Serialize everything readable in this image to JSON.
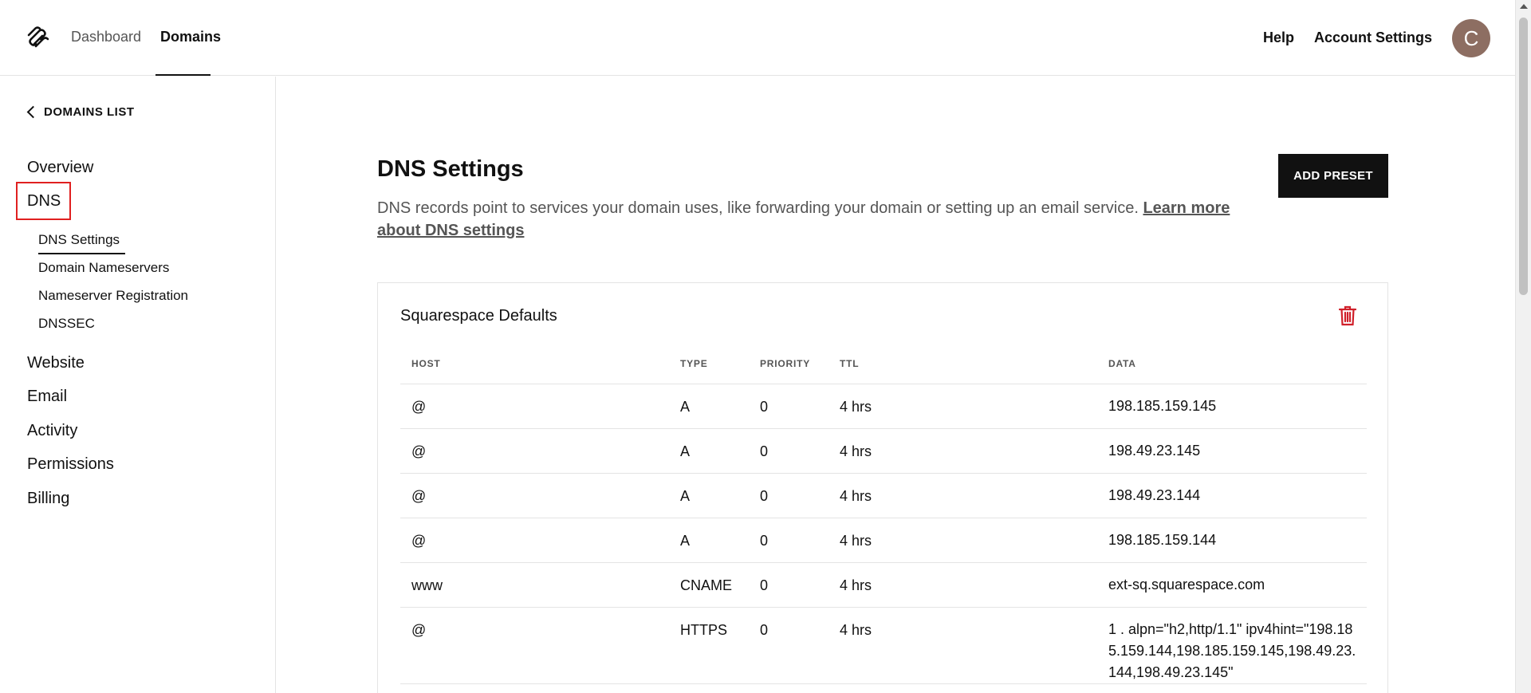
{
  "header": {
    "nav": [
      {
        "label": "Dashboard"
      },
      {
        "label": "Domains"
      }
    ],
    "help_label": "Help",
    "account_label": "Account Settings",
    "avatar_initial": "C"
  },
  "sidebar": {
    "back_label": "DOMAINS LIST",
    "items": [
      {
        "label": "Overview"
      },
      {
        "label": "DNS"
      },
      {
        "label": "Website"
      },
      {
        "label": "Email"
      },
      {
        "label": "Activity"
      },
      {
        "label": "Permissions"
      },
      {
        "label": "Billing"
      }
    ],
    "dns_subitems": [
      {
        "label": "DNS Settings"
      },
      {
        "label": "Domain Nameservers"
      },
      {
        "label": "Nameserver Registration"
      },
      {
        "label": "DNSSEC"
      }
    ]
  },
  "main": {
    "title": "DNS Settings",
    "description": "DNS records point to services your domain uses, like forwarding your domain or setting up an email service.",
    "learn_more_label": "Learn more about DNS settings",
    "add_preset_label": "ADD PRESET",
    "card": {
      "title": "Squarespace Defaults",
      "columns": {
        "host": "HOST",
        "type": "TYPE",
        "priority": "PRIORITY",
        "ttl": "TTL",
        "data": "DATA"
      },
      "rows": [
        {
          "host": "@",
          "type": "A",
          "priority": "0",
          "ttl": "4 hrs",
          "data": "198.185.159.145"
        },
        {
          "host": "@",
          "type": "A",
          "priority": "0",
          "ttl": "4 hrs",
          "data": "198.49.23.145"
        },
        {
          "host": "@",
          "type": "A",
          "priority": "0",
          "ttl": "4 hrs",
          "data": "198.49.23.144"
        },
        {
          "host": "@",
          "type": "A",
          "priority": "0",
          "ttl": "4 hrs",
          "data": "198.185.159.144"
        },
        {
          "host": "www",
          "type": "CNAME",
          "priority": "0",
          "ttl": "4 hrs",
          "data": "ext-sq.squarespace.com"
        },
        {
          "host": "@",
          "type": "HTTPS",
          "priority": "0",
          "ttl": "4 hrs",
          "data": "1 . alpn=\"h2,http/1.1\" ipv4hint=\"198.185.159.144,198.185.159.145,198.49.23.144,198.49.23.145\""
        }
      ]
    }
  },
  "colors": {
    "accent": "#111111",
    "highlight_box": "#e02020",
    "trash_icon": "#d0202a",
    "avatar_bg": "#8d6e62"
  }
}
